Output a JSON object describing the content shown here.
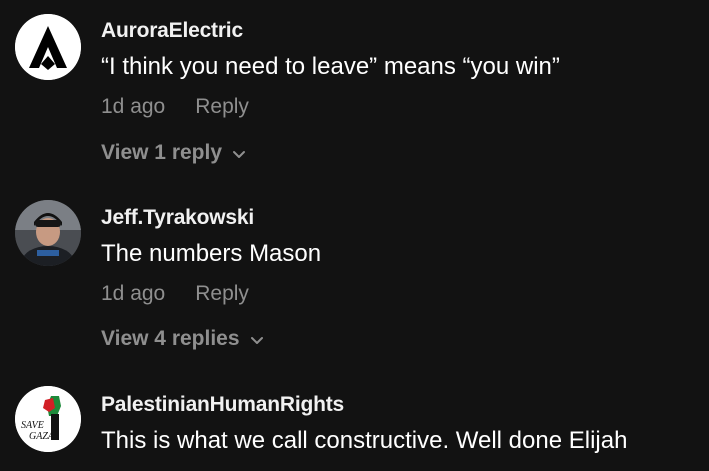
{
  "comments": [
    {
      "username": "AuroraElectric",
      "text": "“I think you need to leave” means “you win”",
      "time": "1d ago",
      "reply_label": "Reply",
      "view_replies": "View 1 reply",
      "avatar_icon": "aurora-logo-icon"
    },
    {
      "username": "Jeff.Tyrakowski",
      "text": "The numbers Mason",
      "time": "1d ago",
      "reply_label": "Reply",
      "view_replies": "View 4 replies",
      "avatar_icon": "hockey-player-photo"
    },
    {
      "username": "PalestinianHumanRights",
      "text": "This is what we call constructive. Well done Elijah",
      "avatar_icon": "save-gaza-logo",
      "avatar_text": "SAVE GAZA"
    }
  ],
  "colors": {
    "background": "#121212",
    "username": "#f1f1f1",
    "text": "#ffffff",
    "meta": "#8f8f8f"
  }
}
